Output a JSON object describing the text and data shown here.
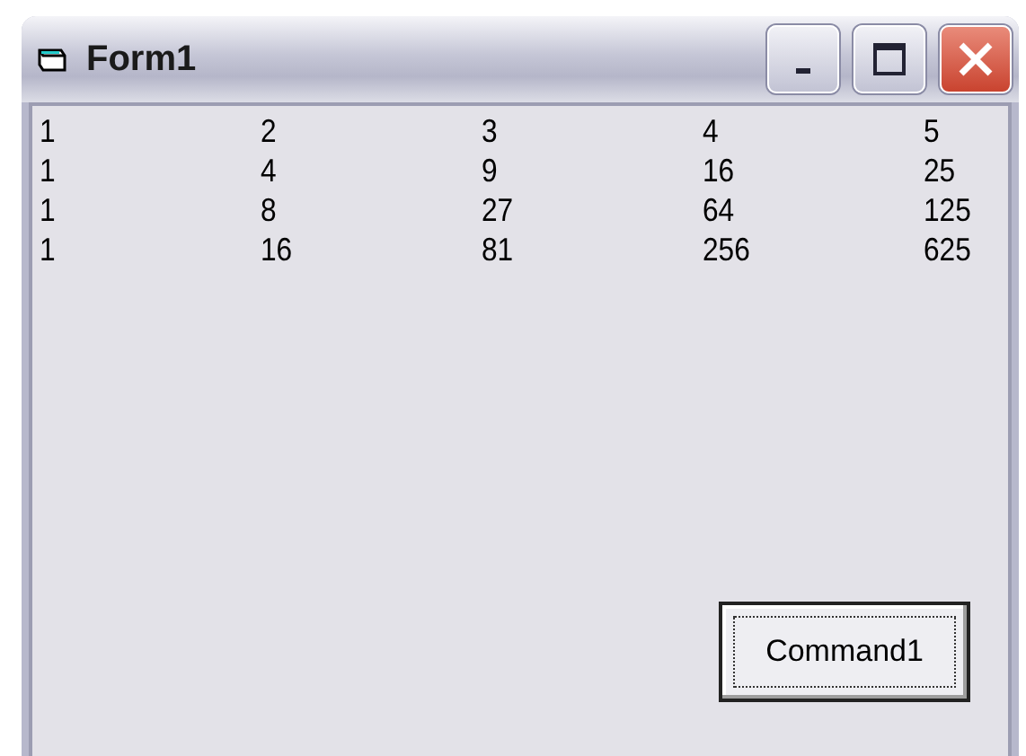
{
  "window": {
    "title": "Form1"
  },
  "rows": [
    [
      "1",
      "2",
      "3",
      "4",
      "5"
    ],
    [
      "1",
      "4",
      "9",
      "16",
      "25"
    ],
    [
      "1",
      "8",
      "27",
      "64",
      "125"
    ],
    [
      "1",
      "16",
      "81",
      "256",
      "625"
    ]
  ],
  "button": {
    "label": "Command1",
    "focused": true
  }
}
